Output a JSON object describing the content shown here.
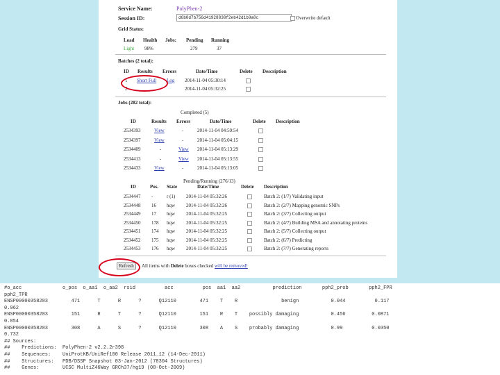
{
  "service": {
    "label": "Service Name:",
    "value": "PolyPhen-2"
  },
  "session": {
    "label": "Session ID:",
    "value": "d6b8d7b756d41928830f2eb42d1b9a0c",
    "overwrite_label": "Overwrite default"
  },
  "grid": {
    "title": "Grid Status:",
    "headers": [
      "Load",
      "Health",
      "Jobs:",
      "Pending",
      "Running"
    ],
    "load": "Light",
    "health": "98%",
    "pending": "279",
    "running": "37"
  },
  "batches": {
    "title": "Batches (2 total):",
    "headers": [
      "ID",
      "Results",
      "Errors",
      "Date/Time",
      "Delete",
      "Description"
    ],
    "rows": [
      {
        "id": "1",
        "results": "Short Full",
        "errors": "Log",
        "datetime": "2014-11-04 05:30:14"
      },
      {
        "id": "2",
        "results": "",
        "errors": "",
        "datetime": "2014-11-04 05:32:25"
      }
    ]
  },
  "jobs": {
    "title": "Jobs (282 total):",
    "completed_title": "Completed (5)",
    "headers": [
      "ID",
      "Results",
      "Errors",
      "Date/Time",
      "Delete",
      "Description"
    ],
    "rows": [
      {
        "id": "2534393",
        "results": "View",
        "errors": "-",
        "datetime": "2014-11-04 04:59:54"
      },
      {
        "id": "2534397",
        "results": "View",
        "errors": "-",
        "datetime": "2014-11-04 05:04:15"
      },
      {
        "id": "2534409",
        "results": "-",
        "errors": "View",
        "datetime": "2014-11-04 05:13:29"
      },
      {
        "id": "2534413",
        "results": "-",
        "errors": "View",
        "datetime": "2014-11-04 05:13:55"
      },
      {
        "id": "2534433",
        "results": "View",
        "errors": "-",
        "datetime": "2014-11-04 05:13:05"
      }
    ]
  },
  "pending": {
    "title": "Pending/Running (276/13)",
    "headers": [
      "ID",
      "Pos.",
      "State",
      "Date/Time",
      "Delete",
      "Description"
    ],
    "rows": [
      {
        "id": "2534447",
        "pos": "-",
        "state": "r (1)",
        "datetime": "2014-11-04 05:32:26",
        "desc": "Batch 2: (1/7) Validating input"
      },
      {
        "id": "2534448",
        "pos": "16",
        "state": "hqw",
        "datetime": "2014-11-04 05:32:26",
        "desc": "Batch 2: (2/7) Mapping genomic SNPs"
      },
      {
        "id": "2534449",
        "pos": "17",
        "state": "hqw",
        "datetime": "2014-11-04 05:32:25",
        "desc": "Batch 2: (3/7) Collecting output"
      },
      {
        "id": "2534450",
        "pos": "178",
        "state": "hqw",
        "datetime": "2014-11-04 05:32:25",
        "desc": "Batch 2: (4/7) Building MSA and annotating proteins"
      },
      {
        "id": "2534451",
        "pos": "174",
        "state": "hqw",
        "datetime": "2014-11-04 05:32:25",
        "desc": "Batch 2: (5/7) Collecting output"
      },
      {
        "id": "2534452",
        "pos": "175",
        "state": "hqw",
        "datetime": "2014-11-04 05:32:25",
        "desc": "Batch 2: (6/7) Predicting"
      },
      {
        "id": "2534453",
        "pos": "176",
        "state": "hqw",
        "datetime": "2014-11-04 05:32:25",
        "desc": "Batch 2: (7/7) Generating reports"
      }
    ]
  },
  "refresh": {
    "button": "Refresh",
    "note_pre": "All items with ",
    "note_bold": "Delete",
    "note_mid": " boxes checked ",
    "note_link": "will be removed!"
  },
  "output": {
    "lines": [
      "#o_acc              o_pos  o_aa1  o_aa2  rsid          acc          pos  aa1  aa2           prediction       pph2_prob       pph2_FPR",
      "pph2_TPR",
      "ENSP00000358283        471      T      R      ?      Q12110        471    T    R               benign           0.044          0.117",
      "0.962",
      "ENSP00000358283        151      R      T      ?      Q12110        151    R    T    possibly damaging           0.456         0.0871",
      "0.854",
      "ENSP00000358283        308      A      S      ?      Q12110        308    A    S    probably damaging           0.99          0.0350",
      "0.732",
      "## Sources:",
      "##    Predictions:  PolyPhen-2 v2.2.2r398",
      "##    Sequences:    UniProtKB/UniRef100 Release 2011_12 (14-Dec-2011)",
      "##    Structures:   PDB/DSSP Snapshot 03-Jan-2012 (78304 Structures)",
      "##    Genes:        UCSC MultiZ46Way GRCh37/hg19 (08-Oct-2009)"
    ]
  }
}
